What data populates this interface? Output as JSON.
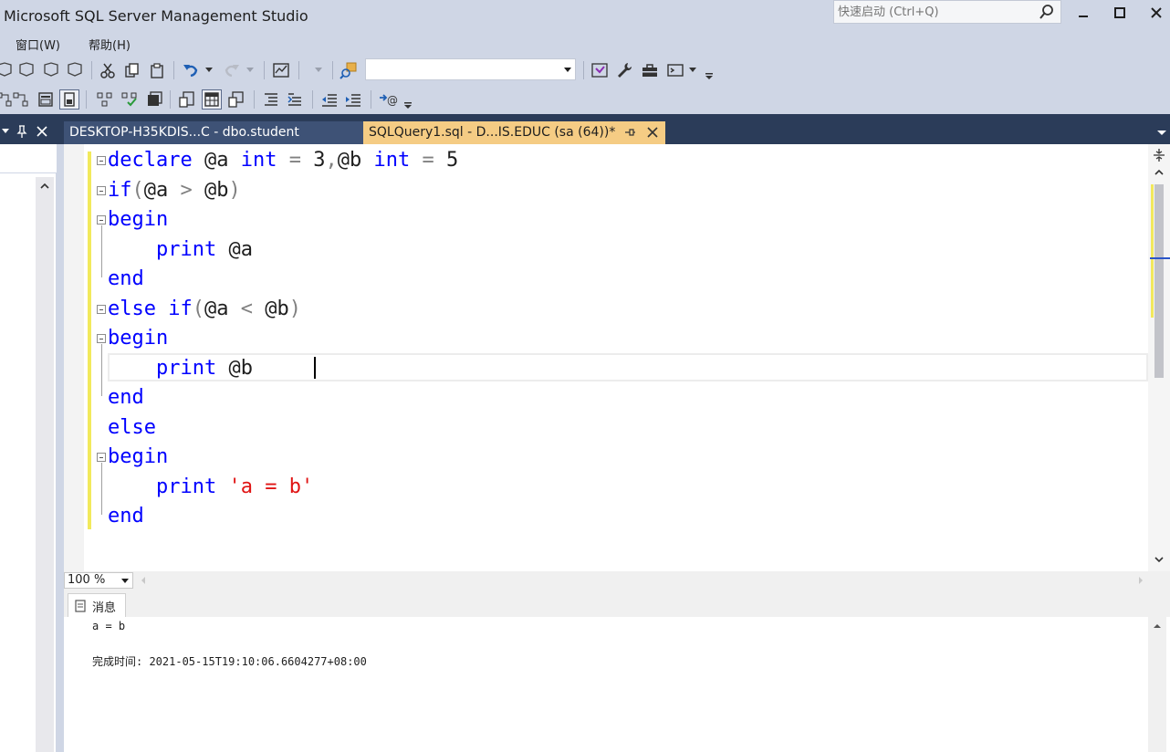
{
  "window": {
    "title": "Microsoft SQL Server Management Studio",
    "quick_launch_placeholder": "快速启动 (Ctrl+Q)"
  },
  "menu": {
    "items": [
      "窗口(W)",
      "帮助(H)"
    ]
  },
  "toolbar": {
    "database_combo_value": ""
  },
  "tabs": [
    {
      "label": "DESKTOP-H35KDIS...C - dbo.student",
      "active": false
    },
    {
      "label": "SQLQuery1.sql - D...IS.EDUC (sa (64))*",
      "active": true
    }
  ],
  "editor": {
    "lines": [
      "declare @a int = 3,@b int = 5",
      "if(@a > @b)",
      "begin",
      "    print @a",
      "end",
      "else if(@a < @b)",
      "begin",
      "    print @b",
      "end",
      "else",
      "begin",
      "    print 'a = b'",
      "end"
    ],
    "zoom": "100 %"
  },
  "results": {
    "tab_label": "消息",
    "messages": [
      "a = b",
      "完成时间: 2021-05-15T19:10:06.6604277+08:00"
    ]
  },
  "colors": {
    "keyword": "#0000ff",
    "operator": "#808080",
    "string": "#e01414",
    "active_tab": "#f5cc84",
    "tab_band": "#2b3c59"
  }
}
